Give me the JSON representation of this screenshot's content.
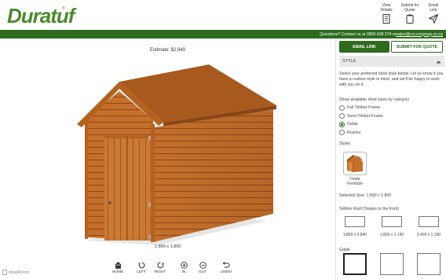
{
  "header": {
    "logo": "Duratuf",
    "logo_mark": "®",
    "actions": [
      {
        "label_line1": "View",
        "label_line2": "Details",
        "icon": "list-document-icon"
      },
      {
        "label_line1": "Submit for",
        "label_line2": "Quote",
        "icon": "clipboard-icon"
      },
      {
        "label_line1": "Email",
        "label_line2": "Link",
        "icon": "send-icon"
      }
    ]
  },
  "contact_bar": {
    "text": "Questions? Contact us at 0800 438 274 or ",
    "email": "sales@crv.crvgroup.co.nz"
  },
  "viewer": {
    "estimate": "Estimate: $2,949",
    "size_label": "1.890 x 1.800",
    "watermark": "idealRoom",
    "controls": [
      {
        "label": "HOME",
        "icon": "home-icon"
      },
      {
        "label": "LEFT",
        "icon": "rotate-left-icon"
      },
      {
        "label": "RIGHT",
        "icon": "rotate-right-icon"
      },
      {
        "label": "IN",
        "icon": "zoom-in-icon"
      },
      {
        "label": "OUT",
        "icon": "zoom-out-icon"
      },
      {
        "label": "UNDO",
        "icon": "undo-icon"
      }
    ]
  },
  "panel": {
    "email_button": "EMAIL LINK",
    "quote_button": "SUBMIT FOR QUOTE",
    "section": "STYLE",
    "intro": "Select your preferred shed style below. Let us know if you have a custom style in mind, and we'll be happy to work with you on it.",
    "category_title": "Show available shed sizes by category",
    "categories": [
      {
        "label": "Full Timber Frame",
        "selected": false
      },
      {
        "label": "Semi-Timber Frame",
        "selected": false
      },
      {
        "label": "Cedar",
        "selected": true
      },
      {
        "label": "Rustica",
        "selected": false
      }
    ],
    "styles_title": "Styles",
    "style_name_line1": "Cedar",
    "style_name_line2": "Ferndale",
    "selected_size": "Selected Size: 1.890 x 1.800",
    "roof_title": "Skillion Roof (Slopes to the front)",
    "roof_options": [
      "1.800 x 0.840",
      "1.800 x 1.190",
      "2.400 x 1.190"
    ],
    "gable_title": "Gable"
  },
  "colors": {
    "brand_green": "#2e6b1f",
    "logo_green": "#4b8a2a",
    "cedar": "#c8752f"
  }
}
